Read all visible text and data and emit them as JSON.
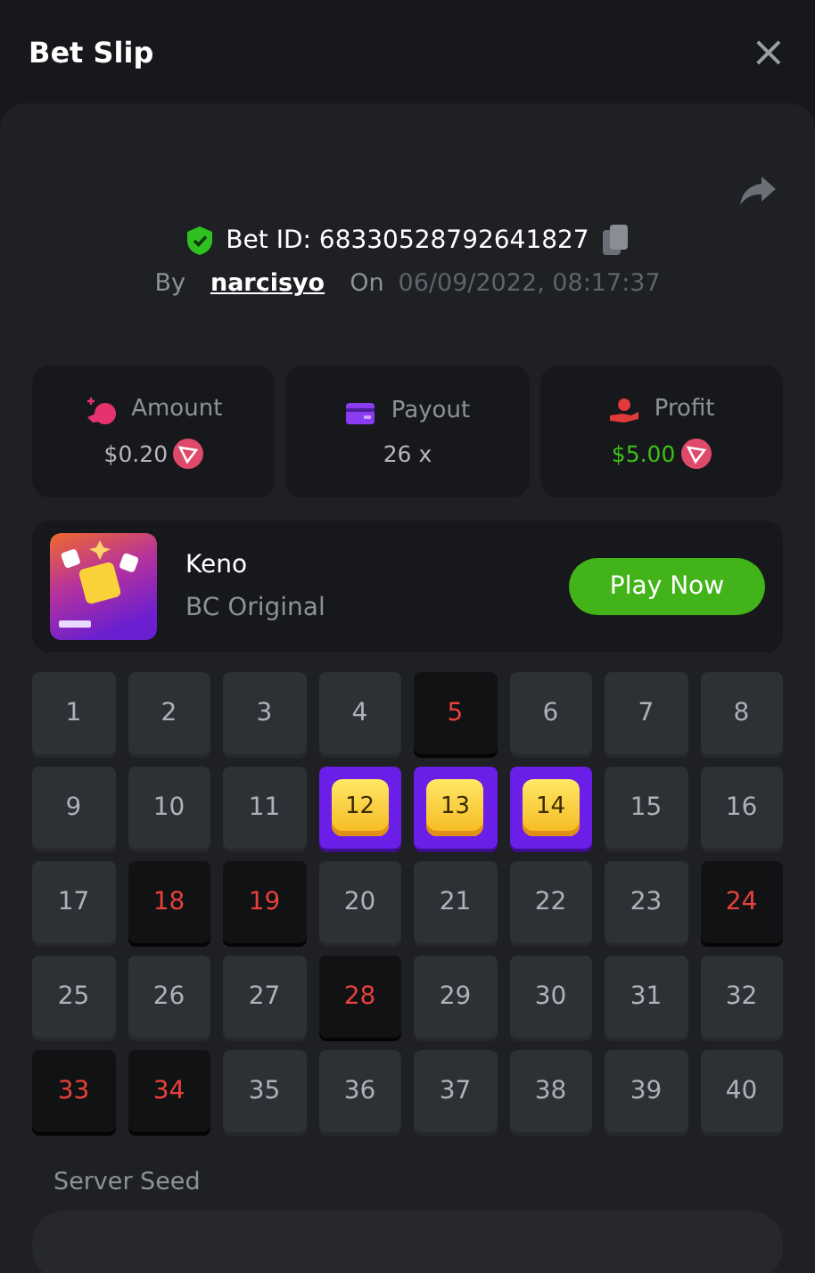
{
  "header": {
    "title": "Bet Slip",
    "close": "×"
  },
  "bet": {
    "verified": true,
    "id_label": "Bet ID: 68330528792641827",
    "by_label": "By",
    "user": "narcisyo",
    "on_label": "On",
    "date": "06/09/2022, 08:17:37"
  },
  "stats": [
    {
      "kind": "amount",
      "label": "Amount",
      "value": "$0.20",
      "coin": true,
      "positive": false
    },
    {
      "kind": "payout",
      "label": "Payout",
      "value": "26 x",
      "coin": false,
      "positive": false
    },
    {
      "kind": "profit",
      "label": "Profit",
      "value": "$5.00",
      "coin": true,
      "positive": true
    }
  ],
  "game": {
    "name": "Keno",
    "provider": "BC Original",
    "button": "Play Now"
  },
  "cells": [
    {
      "number": "1",
      "kind": "plain"
    },
    {
      "number": "2",
      "kind": "plain"
    },
    {
      "number": "3",
      "kind": "plain"
    },
    {
      "number": "4",
      "kind": "plain"
    },
    {
      "number": "5",
      "kind": "drawn"
    },
    {
      "number": "6",
      "kind": "plain"
    },
    {
      "number": "7",
      "kind": "plain"
    },
    {
      "number": "8",
      "kind": "plain"
    },
    {
      "number": "9",
      "kind": "plain"
    },
    {
      "number": "10",
      "kind": "plain"
    },
    {
      "number": "11",
      "kind": "plain"
    },
    {
      "number": "12",
      "kind": "hit"
    },
    {
      "number": "13",
      "kind": "hit"
    },
    {
      "number": "14",
      "kind": "hit"
    },
    {
      "number": "15",
      "kind": "plain"
    },
    {
      "number": "16",
      "kind": "plain"
    },
    {
      "number": "17",
      "kind": "plain"
    },
    {
      "number": "18",
      "kind": "drawn"
    },
    {
      "number": "19",
      "kind": "drawn"
    },
    {
      "number": "20",
      "kind": "plain"
    },
    {
      "number": "21",
      "kind": "plain"
    },
    {
      "number": "22",
      "kind": "plain"
    },
    {
      "number": "23",
      "kind": "plain"
    },
    {
      "number": "24",
      "kind": "drawn"
    },
    {
      "number": "25",
      "kind": "plain"
    },
    {
      "number": "26",
      "kind": "plain"
    },
    {
      "number": "27",
      "kind": "plain"
    },
    {
      "number": "28",
      "kind": "drawn"
    },
    {
      "number": "29",
      "kind": "plain"
    },
    {
      "number": "30",
      "kind": "plain"
    },
    {
      "number": "31",
      "kind": "plain"
    },
    {
      "number": "32",
      "kind": "plain"
    },
    {
      "number": "33",
      "kind": "drawn"
    },
    {
      "number": "34",
      "kind": "drawn"
    },
    {
      "number": "35",
      "kind": "plain"
    },
    {
      "number": "36",
      "kind": "plain"
    },
    {
      "number": "37",
      "kind": "plain"
    },
    {
      "number": "38",
      "kind": "plain"
    },
    {
      "number": "39",
      "kind": "plain"
    },
    {
      "number": "40",
      "kind": "plain"
    }
  ],
  "server_seed": {
    "label": "Server Seed"
  }
}
